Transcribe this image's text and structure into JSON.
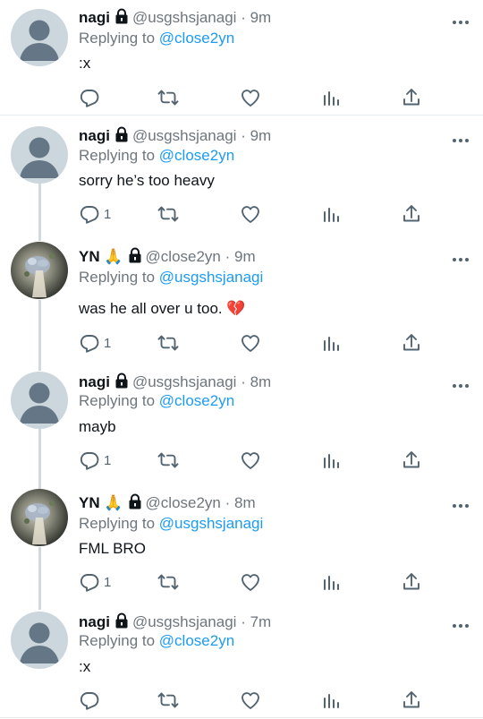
{
  "tweets": [
    {
      "name": "nagi",
      "emoji": "",
      "handle": "@usgshsjanagi",
      "sep": "·",
      "time": "9m",
      "reply_prefix": "Replying to",
      "reply_to": "@close2yn",
      "text": ":x",
      "reply_count": "",
      "avatar": "default"
    },
    {
      "name": "nagi",
      "emoji": "",
      "handle": "@usgshsjanagi",
      "sep": "·",
      "time": "9m",
      "reply_prefix": "Replying to",
      "reply_to": "@close2yn",
      "text": "sorry he’s too heavy",
      "reply_count": "1",
      "avatar": "default"
    },
    {
      "name": "YN",
      "emoji": "🙏",
      "handle": "@close2yn",
      "sep": "·",
      "time": "9m",
      "reply_prefix": "Replying to",
      "reply_to": "@usgshsjanagi",
      "text": "was he all over u too. 💔",
      "reply_count": "1",
      "avatar": "photo"
    },
    {
      "name": "nagi",
      "emoji": "",
      "handle": "@usgshsjanagi",
      "sep": "·",
      "time": "8m",
      "reply_prefix": "Replying to",
      "reply_to": "@close2yn",
      "text": "mayb",
      "reply_count": "1",
      "avatar": "default"
    },
    {
      "name": "YN",
      "emoji": "🙏",
      "handle": "@close2yn",
      "sep": "·",
      "time": "8m",
      "reply_prefix": "Replying to",
      "reply_to": "@usgshsjanagi",
      "text": "FML BRO",
      "reply_count": "1",
      "avatar": "photo"
    },
    {
      "name": "nagi",
      "emoji": "",
      "handle": "@usgshsjanagi",
      "sep": "·",
      "time": "7m",
      "reply_prefix": "Replying to",
      "reply_to": "@close2yn",
      "text": ":x",
      "reply_count": "",
      "avatar": "default"
    }
  ],
  "icons": {
    "reply": "reply-icon",
    "retweet": "retweet-icon",
    "like": "heart-icon",
    "analytics": "analytics-icon",
    "share": "share-icon",
    "more": "more-icon",
    "lock": "lock-icon"
  },
  "colors": {
    "link": "#1d9bf0",
    "muted": "#6e767d",
    "icon": "#536471",
    "avatar_default": "#ccd6dd",
    "thread_line": "#cfd9de"
  }
}
